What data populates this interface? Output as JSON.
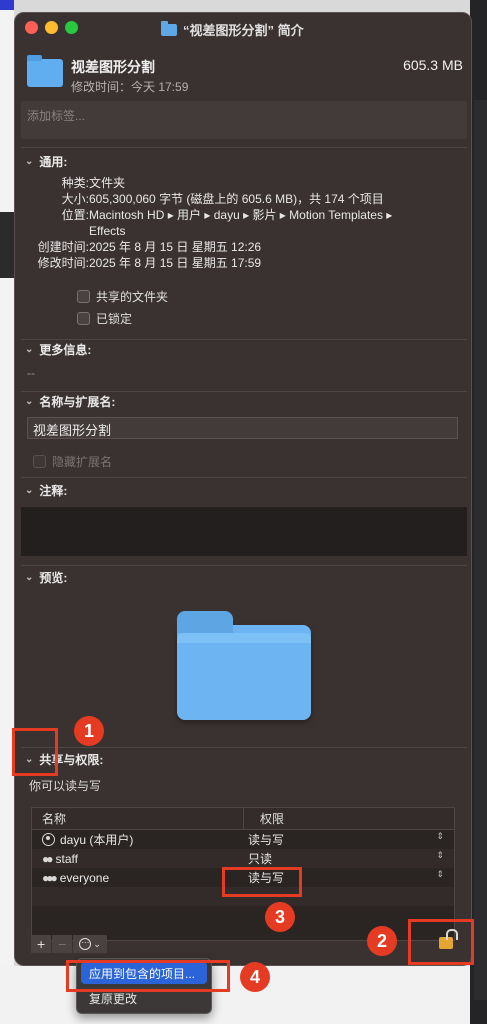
{
  "window": {
    "title": "“视差图形分割” 简介",
    "name": "视差图形分割",
    "modified": "修改时间：今天 17:59",
    "size": "605.3 MB",
    "tags_placeholder": "添加标签..."
  },
  "general": {
    "heading": "通用:",
    "rows": [
      {
        "key": "种类:",
        "value": "文件夹"
      },
      {
        "key": "大小:",
        "value": "605,300,060 字节 (磁盘上的 605.6 MB)，共 174 个项目"
      },
      {
        "key": "位置:",
        "value": "Macintosh HD ▸ 用户 ▸ dayu ▸ 影片 ▸ Motion Templates ▸"
      },
      {
        "key": "",
        "value": "Effects"
      },
      {
        "key": "创建时间:",
        "value": "2025 年 8 月 15 日 星期五 12:26"
      },
      {
        "key": "修改时间:",
        "value": "2025 年 8 月 15 日 星期五 17:59"
      }
    ],
    "shared_label": "共享的文件夹",
    "locked_label": "已锁定"
  },
  "more_info": {
    "heading": "更多信息:",
    "value": "--"
  },
  "name_ext": {
    "heading": "名称与扩展名:",
    "value": "视差图形分割",
    "hide_ext_label": "隐藏扩展名"
  },
  "comments": {
    "heading": "注释:"
  },
  "preview": {
    "heading": "预览:"
  },
  "sharing": {
    "heading": "共享与权限:",
    "status": "你可以读与写",
    "col_name": "名称",
    "col_perm": "权限",
    "rows": [
      {
        "name": "dayu (本用户)",
        "perm": "读与写",
        "icon": "user-icon"
      },
      {
        "name": "staff",
        "perm": "只读",
        "icon": "group-icon"
      },
      {
        "name": "everyone",
        "perm": "读与写",
        "icon": "group-icon"
      }
    ],
    "add": "+",
    "remove": "−",
    "more": "⋯"
  },
  "menu": {
    "apply": "应用到包含的项目...",
    "revert": "复原更改"
  },
  "annotations": {
    "n1": "1",
    "n2": "2",
    "n3": "3",
    "n4": "4"
  },
  "colors": {
    "accent_red": "#e43b22",
    "folder_blue": "#60aef0",
    "menu_highlight": "#2a64d8"
  }
}
